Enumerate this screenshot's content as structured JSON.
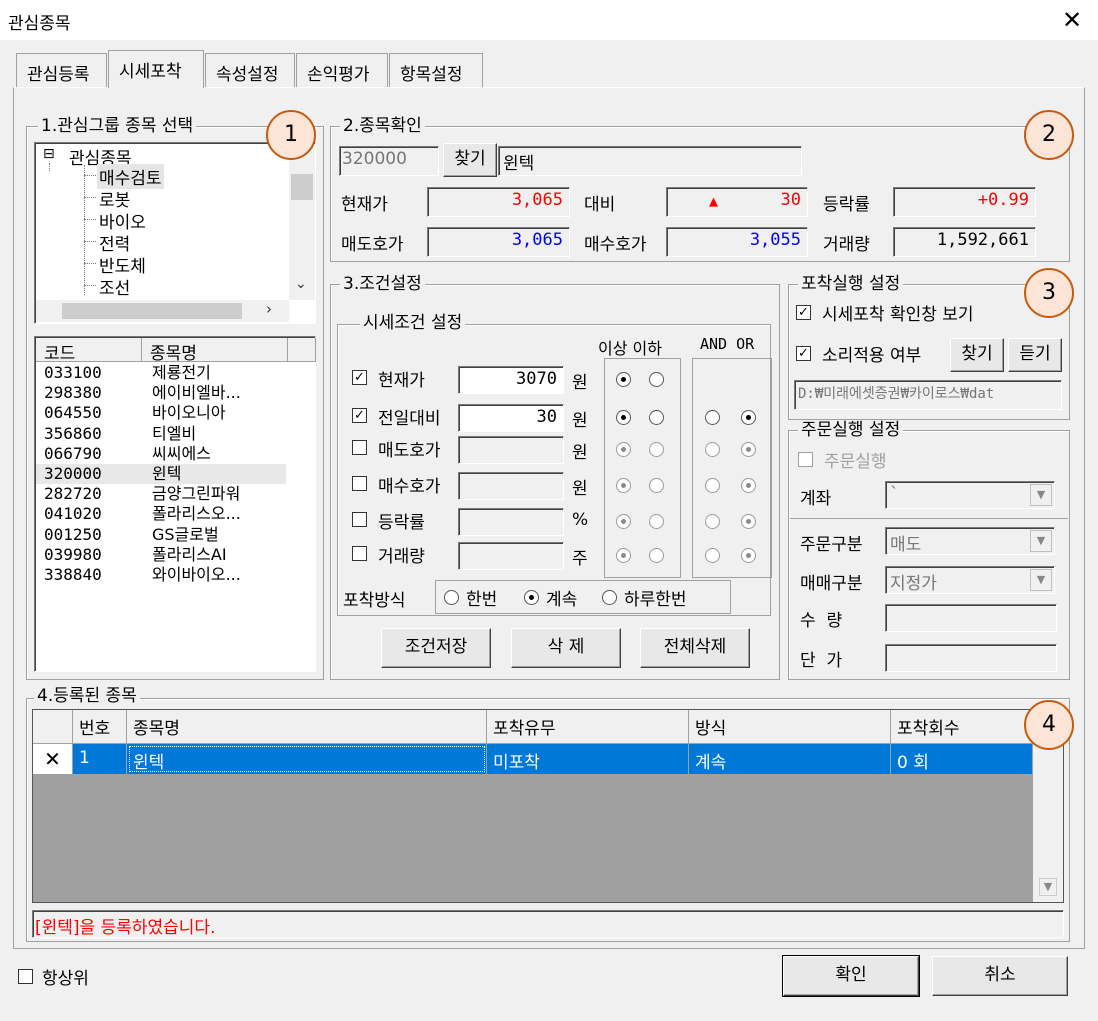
{
  "window": {
    "title": "관심종목",
    "close_glyph": "✕"
  },
  "tabs": [
    {
      "label": "관심등록"
    },
    {
      "label": "시세포착"
    },
    {
      "label": "속성설정"
    },
    {
      "label": "손익평가"
    },
    {
      "label": "항목설정"
    }
  ],
  "active_tab": 1,
  "group1": {
    "title": "1.관심그룹 종목 선택",
    "tree_root": "관심종목",
    "tree_expander": "⊟",
    "tree_items": [
      "매수검토",
      "로봇",
      "바이오",
      "전력",
      "반도체",
      "조선"
    ],
    "selected_tree_item": 0,
    "list_headers": {
      "code": "코드",
      "name": "종목명"
    },
    "stocks": [
      {
        "code": "033100",
        "name": "제룡전기"
      },
      {
        "code": "298380",
        "name": "에이비엘바..."
      },
      {
        "code": "064550",
        "name": "바이오니아"
      },
      {
        "code": "356860",
        "name": "티엘비"
      },
      {
        "code": "066790",
        "name": "씨씨에스"
      },
      {
        "code": "320000",
        "name": "윈텍"
      },
      {
        "code": "282720",
        "name": "금양그린파워"
      },
      {
        "code": "041020",
        "name": "폴라리스오..."
      },
      {
        "code": "001250",
        "name": "GS글로벌"
      },
      {
        "code": "039980",
        "name": "폴라리스AI"
      },
      {
        "code": "338840",
        "name": "와이바이오..."
      }
    ],
    "selected_stock": 5
  },
  "group2": {
    "title": "2.종목확인",
    "code_value": "320000",
    "find_button": "찾기",
    "name_value": "윈텍",
    "labels": {
      "current_price": "현재가",
      "change": "대비",
      "change_rate": "등락률",
      "ask": "매도호가",
      "bid": "매수호가",
      "volume": "거래량"
    },
    "values": {
      "current_price": "3,065",
      "change_arrow": "▲",
      "change": "30",
      "change_rate": "+0.99",
      "ask": "3,065",
      "bid": "3,055",
      "volume": "1,592,661"
    },
    "colors": {
      "up": "#ff0000",
      "down": "#0000ff",
      "neutral": "#000000"
    }
  },
  "group3": {
    "title": "3.조건설정",
    "sub_title": "시세조건 설정",
    "col_above_below": "이상 이하",
    "col_and_or": "AND OR",
    "conditions": [
      {
        "label": "현재가",
        "checked": true,
        "value": "3070",
        "unit": "원",
        "above": true,
        "logic_enabled": false,
        "logic": null,
        "enabled": true
      },
      {
        "label": "전일대비",
        "checked": true,
        "value": "30",
        "unit": "원",
        "above": true,
        "logic_enabled": true,
        "logic": "or",
        "enabled": true
      },
      {
        "label": "매도호가",
        "checked": false,
        "value": "",
        "unit": "원",
        "above": true,
        "logic_enabled": true,
        "logic": "or",
        "enabled": false
      },
      {
        "label": "매수호가",
        "checked": false,
        "value": "",
        "unit": "원",
        "above": true,
        "logic_enabled": true,
        "logic": "or",
        "enabled": false
      },
      {
        "label": "등락률",
        "checked": false,
        "value": "",
        "unit": "%",
        "above": true,
        "logic_enabled": true,
        "logic": "or",
        "enabled": false
      },
      {
        "label": "거래량",
        "checked": false,
        "value": "",
        "unit": "주",
        "above": true,
        "logic_enabled": true,
        "logic": "or",
        "enabled": false
      }
    ],
    "capture_mode_label": "포착방식",
    "capture_modes": [
      "한번",
      "계속",
      "하루한번"
    ],
    "capture_mode_selected": 1,
    "buttons": {
      "save": "조건저장",
      "delete": "삭 제",
      "delete_all": "전체삭제"
    }
  },
  "capture_settings": {
    "title": "포착실행 설정",
    "show_confirm_label": "시세포착 확인창 보기",
    "show_confirm_checked": true,
    "sound_label": "소리적용 여부",
    "sound_checked": true,
    "find_button": "찾기",
    "listen_button": "듣기",
    "sound_path": "D:₩미래에셋증권₩카이로스₩dat"
  },
  "order_settings": {
    "title": "주문실행 설정",
    "order_exec_label": "주문실행",
    "order_exec_checked": false,
    "account_label": "계좌",
    "account_value": "`",
    "order_type_label": "주문구분",
    "order_type_value": "매도",
    "trade_type_label": "매매구분",
    "trade_type_value": "지정가",
    "quantity_label": "수  량",
    "price_label": "단  가"
  },
  "group4": {
    "title": "4.등록된 종목",
    "headers": [
      "번호",
      "종목명",
      "포착유무",
      "방식",
      "포착회수"
    ],
    "rows": [
      {
        "mark": "✕",
        "no": "1",
        "name": "윈텍",
        "captured": "미포착",
        "mode": "계속",
        "count": "0 회"
      }
    ],
    "status_message": "[윈텍]을 등록하였습니다."
  },
  "footer": {
    "always_on_top_label": "항상위",
    "always_on_top_checked": false,
    "ok_button": "확인",
    "cancel_button": "취소"
  },
  "callouts": [
    "1",
    "2",
    "3",
    "4"
  ]
}
